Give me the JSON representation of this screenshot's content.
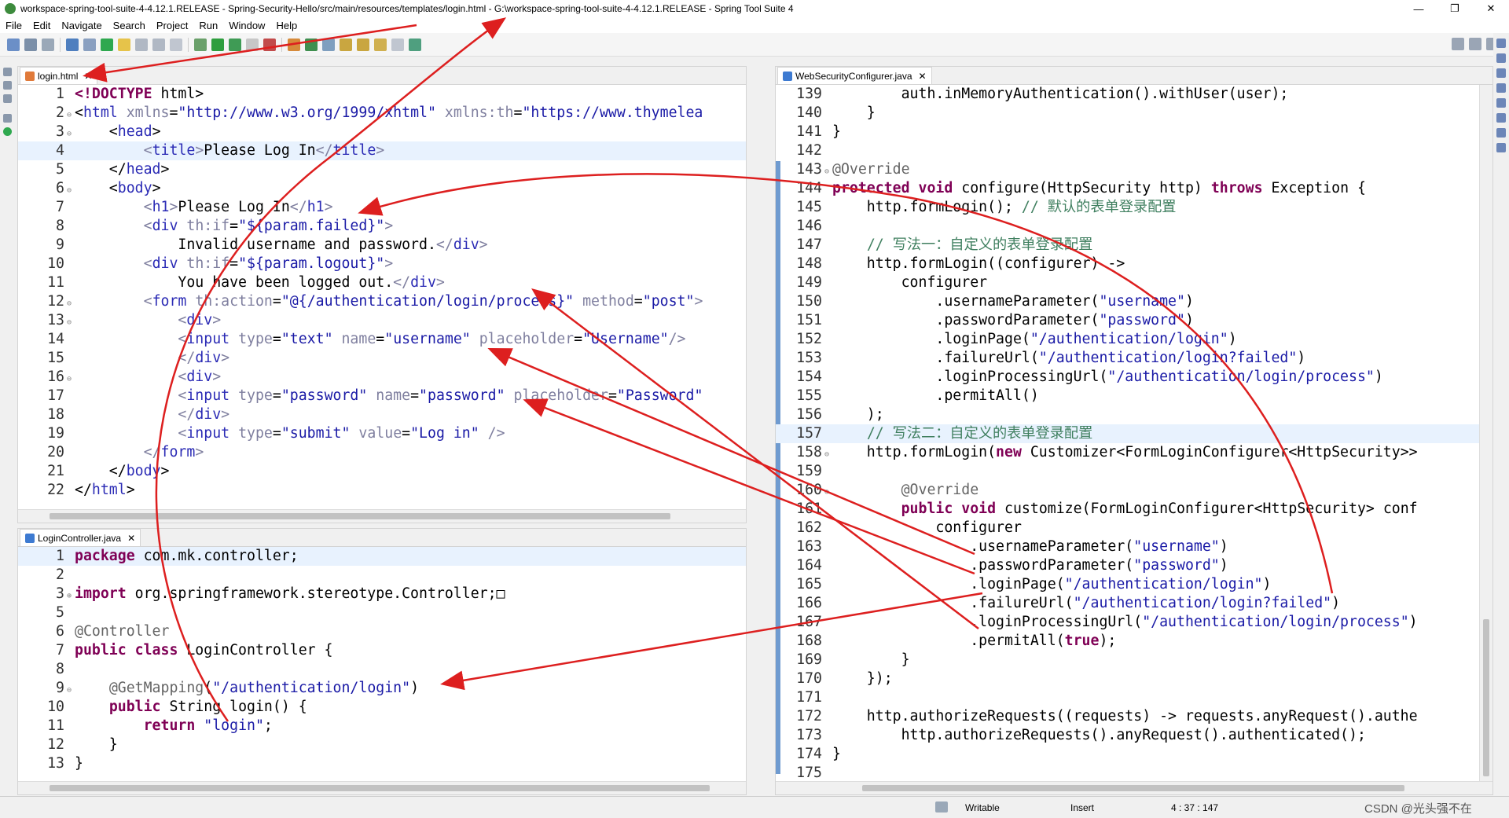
{
  "window": {
    "title": "workspace-spring-tool-suite-4-4.12.1.RELEASE - Spring-Security-Hello/src/main/resources/templates/login.html - G:\\workspace-spring-tool-suite-4-4.12.1.RELEASE - Spring Tool Suite 4",
    "minimize": "—",
    "maximize": "❐",
    "close": "✕"
  },
  "menu": [
    "File",
    "Edit",
    "Navigate",
    "Search",
    "Project",
    "Run",
    "Window",
    "Help"
  ],
  "editors": {
    "login_html": {
      "tab": "login.html",
      "close": "✕",
      "lines": [
        {
          "n": "1",
          "f": "",
          "h": "<span class='k'>&lt;!DOCTYPE</span> html&gt;"
        },
        {
          "n": "2",
          "f": "⊖",
          "h": "&lt;<span class='t'>html</span> <span class='a'>xmlns</span>=<span class='v'>\"http://www.w3.org/1999/xhtml\"</span> <span class='a'>xmlns:th</span>=<span class='v'>\"https://www.thymelea</span>"
        },
        {
          "n": "3",
          "f": "⊖",
          "h": "    &lt;<span class='t'>head</span>&gt;"
        },
        {
          "n": "4",
          "f": "",
          "h": "        <span class='a'>&lt;</span><span class='t'>title</span><span class='a'>&gt;</span>Please Log In<span class='a'>&lt;/</span><span class='t'>title</span><span class='a'>&gt;</span>",
          "hl": true
        },
        {
          "n": "5",
          "f": "",
          "h": "    &lt;/<span class='t'>head</span>&gt;"
        },
        {
          "n": "6",
          "f": "⊖",
          "h": "    &lt;<span class='t'>body</span>&gt;"
        },
        {
          "n": "7",
          "f": "",
          "h": "        <span class='a'>&lt;</span><span class='t'>h1</span><span class='a'>&gt;</span>Please Log In<span class='a'>&lt;/</span><span class='t'>h1</span><span class='a'>&gt;</span>"
        },
        {
          "n": "8",
          "f": "",
          "h": "        <span class='a'>&lt;</span><span class='t'>div</span> <span class='a'>th:if</span>=<span class='v'>\"${param.failed}\"</span><span class='a'>&gt;</span>"
        },
        {
          "n": "9",
          "f": "",
          "h": "            Invalid username and password.<span class='a'>&lt;/</span><span class='t'>div</span><span class='a'>&gt;</span>"
        },
        {
          "n": "10",
          "f": "",
          "h": "        <span class='a'>&lt;</span><span class='t'>div</span> <span class='a'>th:if</span>=<span class='v'>\"${param.logout}\"</span><span class='a'>&gt;</span>"
        },
        {
          "n": "11",
          "f": "",
          "h": "            You have been logged out.<span class='a'>&lt;/</span><span class='t'>div</span><span class='a'>&gt;</span>"
        },
        {
          "n": "12",
          "f": "⊖",
          "h": "        <span class='a'>&lt;</span><span class='t'>form</span> <span class='a'>th:action</span>=<span class='v'>\"@{/authentication/login/process}\"</span> <span class='a'>method</span>=<span class='v'>\"post\"</span><span class='a'>&gt;</span>"
        },
        {
          "n": "13",
          "f": "⊖",
          "h": "            <span class='a'>&lt;</span><span class='t'>div</span><span class='a'>&gt;</span>"
        },
        {
          "n": "14",
          "f": "",
          "h": "            <span class='a'>&lt;</span><span class='t'>input</span> <span class='a'>type</span>=<span class='v'>\"text\"</span> <span class='a'>name</span>=<span class='v'>\"username\"</span> <span class='a'>placeholder</span>=<span class='v'>\"Username\"</span><span class='a'>/&gt;</span>"
        },
        {
          "n": "15",
          "f": "",
          "h": "            <span class='a'>&lt;/</span><span class='t'>div</span><span class='a'>&gt;</span>"
        },
        {
          "n": "16",
          "f": "⊖",
          "h": "            <span class='a'>&lt;</span><span class='t'>div</span><span class='a'>&gt;</span>"
        },
        {
          "n": "17",
          "f": "",
          "h": "            <span class='a'>&lt;</span><span class='t'>input</span> <span class='a'>type</span>=<span class='v'>\"password\"</span> <span class='a'>name</span>=<span class='v'>\"password\"</span> <span class='a'>placeholder</span>=<span class='v'>\"Password\"</span>"
        },
        {
          "n": "18",
          "f": "",
          "h": "            <span class='a'>&lt;/</span><span class='t'>div</span><span class='a'>&gt;</span>"
        },
        {
          "n": "19",
          "f": "",
          "h": "            <span class='a'>&lt;</span><span class='t'>input</span> <span class='a'>type</span>=<span class='v'>\"submit\"</span> <span class='a'>value</span>=<span class='v'>\"Log in\"</span> <span class='a'>/&gt;</span>"
        },
        {
          "n": "20",
          "f": "",
          "h": "        <span class='a'>&lt;/</span><span class='t'>form</span><span class='a'>&gt;</span>"
        },
        {
          "n": "21",
          "f": "",
          "h": "    &lt;/<span class='t'>body</span>&gt;"
        },
        {
          "n": "22",
          "f": "",
          "h": "&lt;/<span class='t'>html</span>&gt;"
        }
      ]
    },
    "login_controller": {
      "tab": "LoginController.java",
      "close": "✕",
      "lines": [
        {
          "n": "1",
          "f": "",
          "h": "<span class='k'>package</span> com.mk.controller;",
          "hl": true
        },
        {
          "n": "2",
          "f": "",
          "h": ""
        },
        {
          "n": "3",
          "f": "⊕",
          "h": "<span class='k'>import</span> org.springframework.stereotype.Controller;□"
        },
        {
          "n": "5",
          "f": "",
          "h": ""
        },
        {
          "n": "6",
          "f": "",
          "h": "<span class='an'>@Controller</span>"
        },
        {
          "n": "7",
          "f": "",
          "h": "<span class='k'>public</span> <span class='k'>class</span> LoginController {"
        },
        {
          "n": "8",
          "f": "",
          "h": ""
        },
        {
          "n": "9",
          "f": "⊖",
          "h": "    <span class='an'>@GetMapping</span>(<span class='v'>\"/authentication/login\"</span>)"
        },
        {
          "n": "10",
          "f": "",
          "h": "    <span class='k'>public</span> String login() {"
        },
        {
          "n": "11",
          "f": "",
          "h": "        <span class='k'>return</span> <span class='v'>\"login\"</span>;"
        },
        {
          "n": "12",
          "f": "",
          "h": "    }"
        },
        {
          "n": "13",
          "f": "",
          "h": "}"
        }
      ]
    },
    "web_security": {
      "tab": "WebSecurityConfigurer.java",
      "close": "✕",
      "lines": [
        {
          "n": "139",
          "f": "",
          "h": "        auth.inMemoryAuthentication().withUser(user);"
        },
        {
          "n": "140",
          "f": "",
          "h": "    }"
        },
        {
          "n": "141",
          "f": "",
          "h": "}"
        },
        {
          "n": "142",
          "f": "",
          "h": ""
        },
        {
          "n": "143",
          "f": "⊖",
          "h": "<span class='an'>@Override</span>"
        },
        {
          "n": "144",
          "f": "",
          "h": "<span class='k'>protected</span> <span class='k'>void</span> configure(HttpSecurity http) <span class='k'>throws</span> Exception {"
        },
        {
          "n": "145",
          "f": "",
          "h": "    http.formLogin(); <span class='c'>// 默认的表单登录配置</span>"
        },
        {
          "n": "146",
          "f": "",
          "h": ""
        },
        {
          "n": "147",
          "f": "",
          "h": "    <span class='c'>// 写法一：自定义的表单登录配置</span>"
        },
        {
          "n": "148",
          "f": "",
          "h": "    http.formLogin((configurer) -&gt;"
        },
        {
          "n": "149",
          "f": "",
          "h": "        configurer"
        },
        {
          "n": "150",
          "f": "",
          "h": "            .usernameParameter(<span class='v'>\"username\"</span>)"
        },
        {
          "n": "151",
          "f": "",
          "h": "            .passwordParameter(<span class='v'>\"password\"</span>)"
        },
        {
          "n": "152",
          "f": "",
          "h": "            .loginPage(<span class='v'>\"/authentication/login\"</span>)"
        },
        {
          "n": "153",
          "f": "",
          "h": "            .failureUrl(<span class='v'>\"/authentication/login?failed\"</span>)"
        },
        {
          "n": "154",
          "f": "",
          "h": "            .loginProcessingUrl(<span class='v'>\"/authentication/login/process\"</span>)"
        },
        {
          "n": "155",
          "f": "",
          "h": "            .permitAll()"
        },
        {
          "n": "156",
          "f": "",
          "h": "    );"
        },
        {
          "n": "157",
          "f": "",
          "h": "    <span class='c'>// 写法二：自定义的表单登录配置</span>",
          "hl": true
        },
        {
          "n": "158",
          "f": "⊖",
          "h": "    http.formLogin(<span class='k'>new</span> Customizer&lt;FormLoginConfigurer&lt;HttpSecurity&gt;&gt;"
        },
        {
          "n": "159",
          "f": "",
          "h": ""
        },
        {
          "n": "160",
          "f": "⊖",
          "h": "        <span class='an'>@Override</span>"
        },
        {
          "n": "161",
          "f": "",
          "h": "        <span class='k'>public</span> <span class='k'>void</span> customize(FormLoginConfigurer&lt;HttpSecurity&gt; conf"
        },
        {
          "n": "162",
          "f": "",
          "h": "            configurer"
        },
        {
          "n": "163",
          "f": "",
          "h": "                .usernameParameter(<span class='v'>\"username\"</span>)"
        },
        {
          "n": "164",
          "f": "",
          "h": "                .passwordParameter(<span class='v'>\"password\"</span>)"
        },
        {
          "n": "165",
          "f": "",
          "h": "                .loginPage(<span class='v'>\"/authentication/login\"</span>)"
        },
        {
          "n": "166",
          "f": "",
          "h": "                .failureUrl(<span class='v'>\"/authentication/login?failed\"</span>)"
        },
        {
          "n": "167",
          "f": "",
          "h": "                .loginProcessingUrl(<span class='v'>\"/authentication/login/process\"</span>)"
        },
        {
          "n": "168",
          "f": "",
          "h": "                .permitAll(<span class='k'>true</span>);"
        },
        {
          "n": "169",
          "f": "",
          "h": "        }"
        },
        {
          "n": "170",
          "f": "",
          "h": "    });"
        },
        {
          "n": "171",
          "f": "",
          "h": ""
        },
        {
          "n": "172",
          "f": "",
          "h": "    http.authorizeRequests((requests) -&gt; requests.anyRequest().authe"
        },
        {
          "n": "173",
          "f": "",
          "h": "        http.authorizeRequests().anyRequest().authenticated();"
        },
        {
          "n": "174",
          "f": "",
          "h": "}"
        },
        {
          "n": "175",
          "f": "",
          "h": ""
        }
      ]
    }
  },
  "status": {
    "writable": "Writable",
    "insert": "Insert",
    "position": "4 : 37 : 147",
    "watermark": "CSDN @光头强不在"
  },
  "colors": {
    "arrow": "#dd1f1f",
    "keyword": "#7f0055",
    "string": "#1a1aa6",
    "comment": "#3f7f5f"
  }
}
